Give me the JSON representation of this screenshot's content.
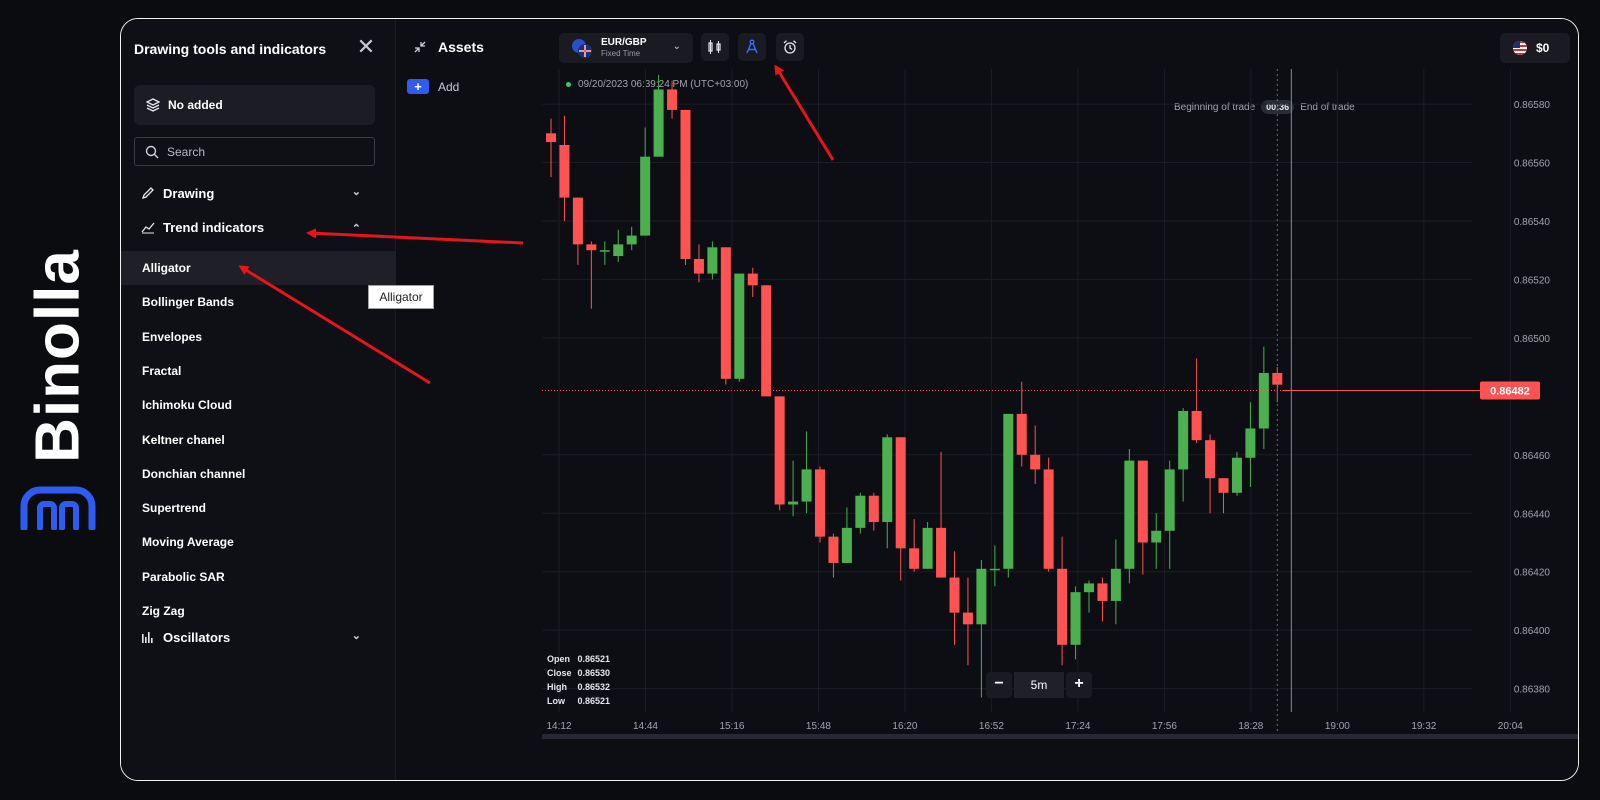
{
  "brand": {
    "name": "Binolla",
    "color": "#2f5cf0"
  },
  "tools_panel": {
    "title": "Drawing tools and indicators",
    "no_added": "No added",
    "search_placeholder": "Search",
    "categories": {
      "drawing": "Drawing",
      "trend": "Trend indicators",
      "oscillators": "Oscillators"
    },
    "trend_items": [
      "Alligator",
      "Bollinger Bands",
      "Envelopes",
      "Fractal",
      "Ichimoku Cloud",
      "Keltner chanel",
      "Donchian channel",
      "Supertrend",
      "Moving Average",
      "Parabolic SAR",
      "Zig Zag"
    ],
    "tooltip": "Alligator"
  },
  "assets_panel": {
    "title": "Assets",
    "add_label": "Add"
  },
  "topbar": {
    "pair": "EUR/GBP",
    "pair_type": "Fixed Time",
    "balance": "$0"
  },
  "chart_info": {
    "timestamp": "09/20/2023  06:39:24 PM  (UTC+03:00)",
    "beginning_label": "Beginning of trade",
    "timer": "00:36",
    "end_label": "End of trade",
    "current_price": "0.86482",
    "timeframe": "5m"
  },
  "ohlc": {
    "open_label": "Open",
    "open": "0.86521",
    "close_label": "Close",
    "close": "0.86530",
    "high_label": "High",
    "high": "0.86532",
    "low_label": "Low",
    "low": "0.86521"
  },
  "colors": {
    "up": "#4caf50",
    "down": "#ff5252",
    "accent": "#2f5cf0",
    "annotation": "#e8141c"
  },
  "chart_data": {
    "type": "candlestick",
    "y_ticks": [
      "0.86580",
      "0.86560",
      "0.86540",
      "0.86520",
      "0.86500",
      "0.86460",
      "0.86440",
      "0.86420",
      "0.86400",
      "0.86380"
    ],
    "x_ticks": [
      "14:12",
      "14:44",
      "15:16",
      "15:48",
      "16:20",
      "16:52",
      "17:24",
      "17:56",
      "18:28",
      "19:00",
      "19:32",
      "20:04"
    ],
    "ylim": [
      0.86372,
      0.86592
    ],
    "current_price": 0.86482,
    "candles": [
      [
        0.8657,
        0.86567,
        0.86575,
        0.86555
      ],
      [
        0.86566,
        0.86548,
        0.86576,
        0.8654
      ],
      [
        0.86548,
        0.86532,
        0.86548,
        0.86525
      ],
      [
        0.86532,
        0.8653,
        0.86533,
        0.8651
      ],
      [
        0.8653,
        0.8653,
        0.86533,
        0.86525
      ],
      [
        0.86528,
        0.86532,
        0.86537,
        0.86526
      ],
      [
        0.86532,
        0.86535,
        0.86538,
        0.8653
      ],
      [
        0.86535,
        0.86562,
        0.86572,
        0.86535
      ],
      [
        0.86562,
        0.86585,
        0.8659,
        0.86562
      ],
      [
        0.86585,
        0.86578,
        0.86588,
        0.86575
      ],
      [
        0.86578,
        0.86527,
        0.86578,
        0.86525
      ],
      [
        0.86527,
        0.86522,
        0.86532,
        0.86519
      ],
      [
        0.86522,
        0.86531,
        0.86533,
        0.8652
      ],
      [
        0.86531,
        0.86486,
        0.86531,
        0.86484
      ],
      [
        0.86486,
        0.86522,
        0.86522,
        0.86485
      ],
      [
        0.86522,
        0.86518,
        0.86524,
        0.86514
      ],
      [
        0.86518,
        0.8648,
        0.86518,
        0.8648
      ],
      [
        0.8648,
        0.86443,
        0.8648,
        0.86441
      ],
      [
        0.86443,
        0.86444,
        0.86458,
        0.86439
      ],
      [
        0.86444,
        0.86455,
        0.86468,
        0.8644
      ],
      [
        0.86455,
        0.86432,
        0.86456,
        0.8643
      ],
      [
        0.86432,
        0.86423,
        0.86433,
        0.86418
      ],
      [
        0.86423,
        0.86435,
        0.86442,
        0.86423
      ],
      [
        0.86435,
        0.86446,
        0.86447,
        0.86433
      ],
      [
        0.86446,
        0.86437,
        0.86447,
        0.86434
      ],
      [
        0.86437,
        0.86466,
        0.86467,
        0.86428
      ],
      [
        0.86466,
        0.86428,
        0.86466,
        0.86417
      ],
      [
        0.86428,
        0.86421,
        0.86438,
        0.8642
      ],
      [
        0.86421,
        0.86435,
        0.86437,
        0.86421
      ],
      [
        0.86435,
        0.86418,
        0.86461,
        0.86418
      ],
      [
        0.86418,
        0.86406,
        0.86427,
        0.86395
      ],
      [
        0.86406,
        0.86402,
        0.86418,
        0.86388
      ],
      [
        0.86402,
        0.86421,
        0.86424,
        0.86377
      ],
      [
        0.86421,
        0.86421,
        0.86429,
        0.86415
      ],
      [
        0.86421,
        0.86474,
        0.86474,
        0.86418
      ],
      [
        0.86474,
        0.8646,
        0.86485,
        0.86456
      ],
      [
        0.8646,
        0.86455,
        0.8647,
        0.8645
      ],
      [
        0.86455,
        0.86421,
        0.86459,
        0.8642
      ],
      [
        0.86421,
        0.86395,
        0.86432,
        0.86388
      ],
      [
        0.86395,
        0.86413,
        0.86415,
        0.8639
      ],
      [
        0.86413,
        0.86416,
        0.86417,
        0.86406
      ],
      [
        0.86416,
        0.8641,
        0.86418,
        0.86403
      ],
      [
        0.8641,
        0.86421,
        0.86431,
        0.86402
      ],
      [
        0.86421,
        0.86458,
        0.86462,
        0.86416
      ],
      [
        0.86458,
        0.8643,
        0.86458,
        0.86419
      ],
      [
        0.8643,
        0.86434,
        0.8644,
        0.86421
      ],
      [
        0.86434,
        0.86455,
        0.86458,
        0.86421
      ],
      [
        0.86455,
        0.86475,
        0.86476,
        0.86444
      ],
      [
        0.86475,
        0.86465,
        0.86493,
        0.86464
      ],
      [
        0.86465,
        0.86452,
        0.86467,
        0.8644
      ],
      [
        0.86452,
        0.86447,
        0.86449,
        0.8644
      ],
      [
        0.86447,
        0.86459,
        0.86461,
        0.86446
      ],
      [
        0.86459,
        0.86469,
        0.86478,
        0.86449
      ],
      [
        0.86469,
        0.86488,
        0.86497,
        0.86462
      ],
      [
        0.86488,
        0.86484,
        0.8649,
        0.86478
      ]
    ]
  }
}
